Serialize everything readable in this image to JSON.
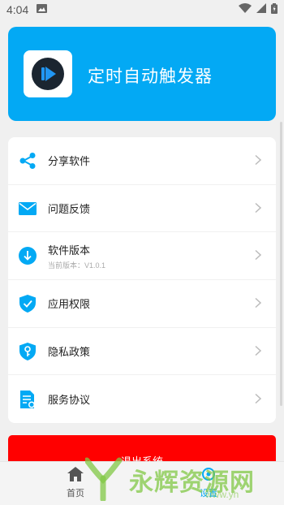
{
  "status_bar": {
    "time": "4:04"
  },
  "header": {
    "app_title": "定时自动触发器"
  },
  "menu": {
    "items": [
      {
        "label": "分享软件",
        "icon": "share-icon"
      },
      {
        "label": "问题反馈",
        "icon": "mail-icon"
      },
      {
        "label": "软件版本",
        "sub": "当前版本：V1.0.1",
        "icon": "download-icon"
      },
      {
        "label": "应用权限",
        "icon": "shield-check-icon"
      },
      {
        "label": "隐私政策",
        "icon": "shield-key-icon"
      },
      {
        "label": "服务协议",
        "icon": "document-icon"
      }
    ]
  },
  "logout": {
    "label": "退出系统"
  },
  "bottom_nav": {
    "home_label": "首页",
    "settings_label": "设置"
  },
  "watermark": {
    "text": "永辉资源网",
    "url": "www.yh"
  },
  "colors": {
    "accent": "#03a9f4",
    "danger": "#ff0000"
  }
}
